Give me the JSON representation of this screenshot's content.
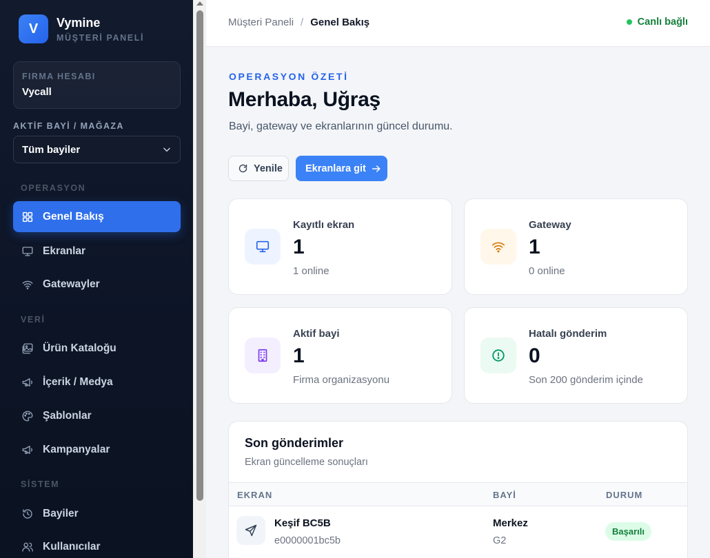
{
  "brand": {
    "logo_letter": "V",
    "name": "Vymine",
    "subtitle": "MÜŞTERİ PANELİ"
  },
  "firm": {
    "label": "FIRMA HESABI",
    "name": "Vycall"
  },
  "store_select": {
    "label": "AKTİF BAYİ / MAĞAZA",
    "value": "Tüm bayiler"
  },
  "nav": {
    "section_ops": "OPERASYON",
    "section_data": "VERİ",
    "section_system": "SİSTEM",
    "items": [
      {
        "label": "Genel Bakış",
        "icon": "grid-icon",
        "active": true
      },
      {
        "label": "Ekranlar",
        "icon": "monitor-icon"
      },
      {
        "label": "Gatewayler",
        "icon": "wifi-icon"
      },
      {
        "label": "Ürün Kataloğu",
        "icon": "image-icon"
      },
      {
        "label": "İçerik / Medya",
        "icon": "megaphone-icon"
      },
      {
        "label": "Şablonlar",
        "icon": "palette-icon"
      },
      {
        "label": "Kampanyalar",
        "icon": "megaphone-icon"
      },
      {
        "label": "Bayiler",
        "icon": "history-icon"
      },
      {
        "label": "Kullanıcılar",
        "icon": "users-icon"
      }
    ]
  },
  "header": {
    "breadcrumb_root": "Müşteri Paneli",
    "breadcrumb_sep": "/",
    "breadcrumb_current": "Genel Bakış",
    "status": "Canlı bağlı"
  },
  "hero": {
    "eyebrow": "OPERASYON ÖZETİ",
    "title": "Merhaba, Uğraş",
    "subtitle": "Bayi, gateway ve ekranlarının güncel durumu."
  },
  "actions": {
    "refresh": "Yenile",
    "go_screens": "Ekranlara git"
  },
  "stats": [
    {
      "label": "Kayıtlı ekran",
      "value": "1",
      "sub": "1 online",
      "icon": "monitor-icon",
      "color": "#2563eb"
    },
    {
      "label": "Gateway",
      "value": "1",
      "sub": "0 online",
      "icon": "wifi-icon",
      "color": "#d97706"
    },
    {
      "label": "Aktif bayi",
      "value": "1",
      "sub": "Firma organizasyonu",
      "icon": "building-icon",
      "color": "#7c3aed"
    },
    {
      "label": "Hatalı gönderim",
      "value": "0",
      "sub": "Son 200 gönderim içinde",
      "icon": "alert-circle-icon",
      "color": "#059669"
    }
  ],
  "recent": {
    "title": "Son gönderimler",
    "subtitle": "Ekran güncelleme sonuçları",
    "columns": [
      "EKRAN",
      "BAYİ",
      "DURUM"
    ],
    "rows": [
      {
        "screen": "Keşif BC5B",
        "screen_id": "e0000001bc5b",
        "store": "Merkez",
        "store_code": "G2",
        "status": "Başarılı"
      }
    ]
  }
}
